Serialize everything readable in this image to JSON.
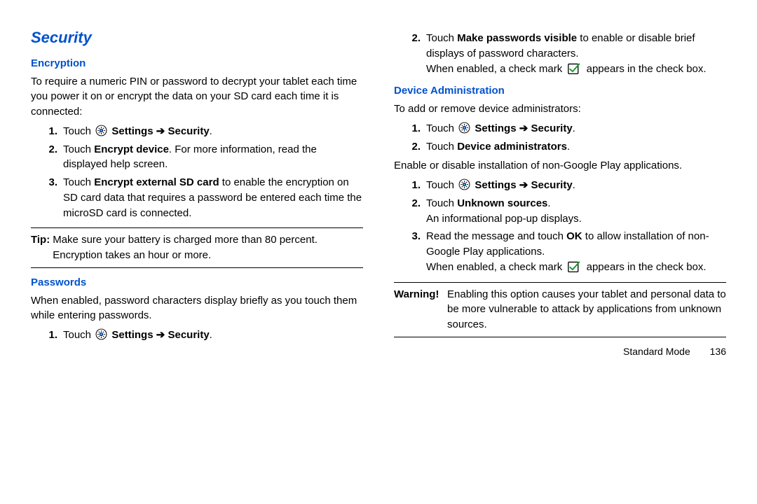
{
  "title": "Security",
  "encryption": {
    "heading": "Encryption",
    "intro": "To require a numeric PIN or password to decrypt your tablet each time you power it on or encrypt the data on your SD card each time it is connected:",
    "s1_touch": "Touch ",
    "s1_settings": "Settings",
    "s1_arrow": " ➔ ",
    "s1_security": "Security",
    "s1_period": ".",
    "s2_touch": "Touch ",
    "s2_bold": "Encrypt device",
    "s2_rest": ". For more information, read the displayed help screen.",
    "s3_touch": "Touch ",
    "s3_bold": "Encrypt external SD card",
    "s3_rest": " to enable the encryption on SD card data that requires a password be entered each time the microSD card is connected.",
    "tip_label": "Tip:",
    "tip_text": " Make sure your battery is charged more than 80 percent. Encryption takes an hour or more."
  },
  "passwords": {
    "heading": "Passwords",
    "intro": "When enabled, password characters display briefly as you touch them while entering passwords.",
    "s1_touch": "Touch ",
    "s1_settings": "Settings",
    "s1_arrow": " ➔ ",
    "s1_security": "Security",
    "s1_period": ".",
    "s2_touch": "Touch ",
    "s2_bold": "Make passwords visible",
    "s2_rest": " to enable or disable brief displays of password characters.",
    "s2_enabled1": "When enabled, a check mark ",
    "s2_enabled2": " appears in the check box."
  },
  "devadmin": {
    "heading": "Device Administration",
    "intro": "To add or remove device administrators:",
    "a1_touch": "Touch ",
    "a1_settings": "Settings",
    "a1_arrow": " ➔ ",
    "a1_security": "Security",
    "a1_period": ".",
    "a2_touch": "Touch ",
    "a2_bold": "Device administrators",
    "a2_period": ".",
    "intro2": "Enable or disable installation of non-Google Play applications.",
    "b1_touch": "Touch ",
    "b1_settings": "Settings",
    "b1_arrow": " ➔ ",
    "b1_security": "Security",
    "b1_period": ".",
    "b2_touch": "Touch ",
    "b2_bold": "Unknown sources",
    "b2_period": ".",
    "b2_popup": "An informational pop-up displays.",
    "b3_read": "Read the message and touch ",
    "b3_ok": "OK",
    "b3_rest": " to allow installation of non-Google Play applications.",
    "b3_enabled1": "When enabled, a check mark ",
    "b3_enabled2": " appears in the check box.",
    "warn_label": "Warning!",
    "warn_text": " Enabling this option causes your tablet and personal data to be more vulnerable to attack by applications from unknown sources."
  },
  "footer": {
    "mode": "Standard Mode",
    "page": "136"
  },
  "nums": {
    "n1": "1.",
    "n2": "2.",
    "n3": "3."
  }
}
